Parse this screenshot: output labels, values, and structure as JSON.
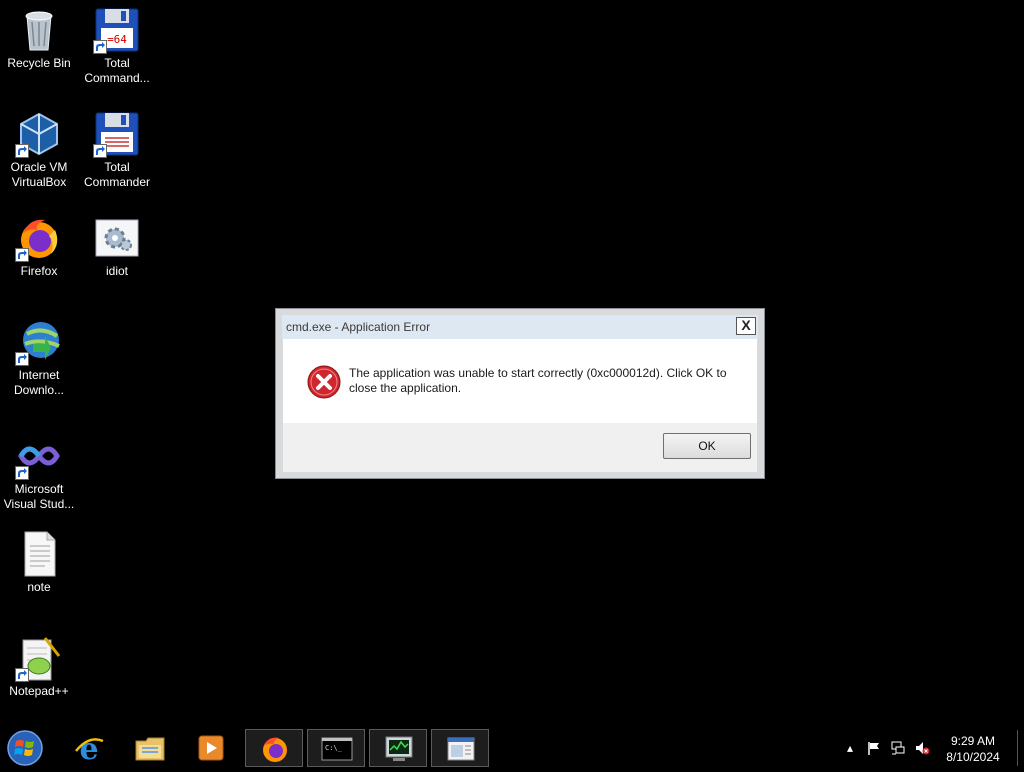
{
  "desktop_icons": [
    {
      "label": "Recycle Bin"
    },
    {
      "label": "Total Command..."
    },
    {
      "label": "Oracle VM VirtualBox"
    },
    {
      "label": "Total Commander"
    },
    {
      "label": "Firefox"
    },
    {
      "label": "idiot"
    },
    {
      "label": "Internet Downlo..."
    },
    {
      "label": "Microsoft Visual Stud..."
    },
    {
      "label": "note"
    },
    {
      "label": "Notepad++"
    }
  ],
  "dialog": {
    "title": "cmd.exe - Application Error",
    "close_label": "X",
    "message": "The application was unable to start correctly (0xc000012d). Click OK to close the application.",
    "ok_label": "OK",
    "icon": "error-icon"
  },
  "taskbar": {
    "items": [
      {
        "icon": "start-orb-icon"
      },
      {
        "icon": "internet-explorer-icon"
      },
      {
        "icon": "file-explorer-icon"
      },
      {
        "icon": "media-player-icon"
      },
      {
        "icon": "firefox-icon",
        "active": true
      },
      {
        "icon": "cmd-icon",
        "active": true
      },
      {
        "icon": "task-manager-icon",
        "active": true
      },
      {
        "icon": "window-app-icon",
        "active": true
      }
    ]
  },
  "tray": {
    "time": "9:29 AM",
    "date": "8/10/2024"
  },
  "colors": {
    "desktop_bg": "#000000",
    "error_red": "#d0262d",
    "dialog_title_bg": "#dee8f2"
  }
}
